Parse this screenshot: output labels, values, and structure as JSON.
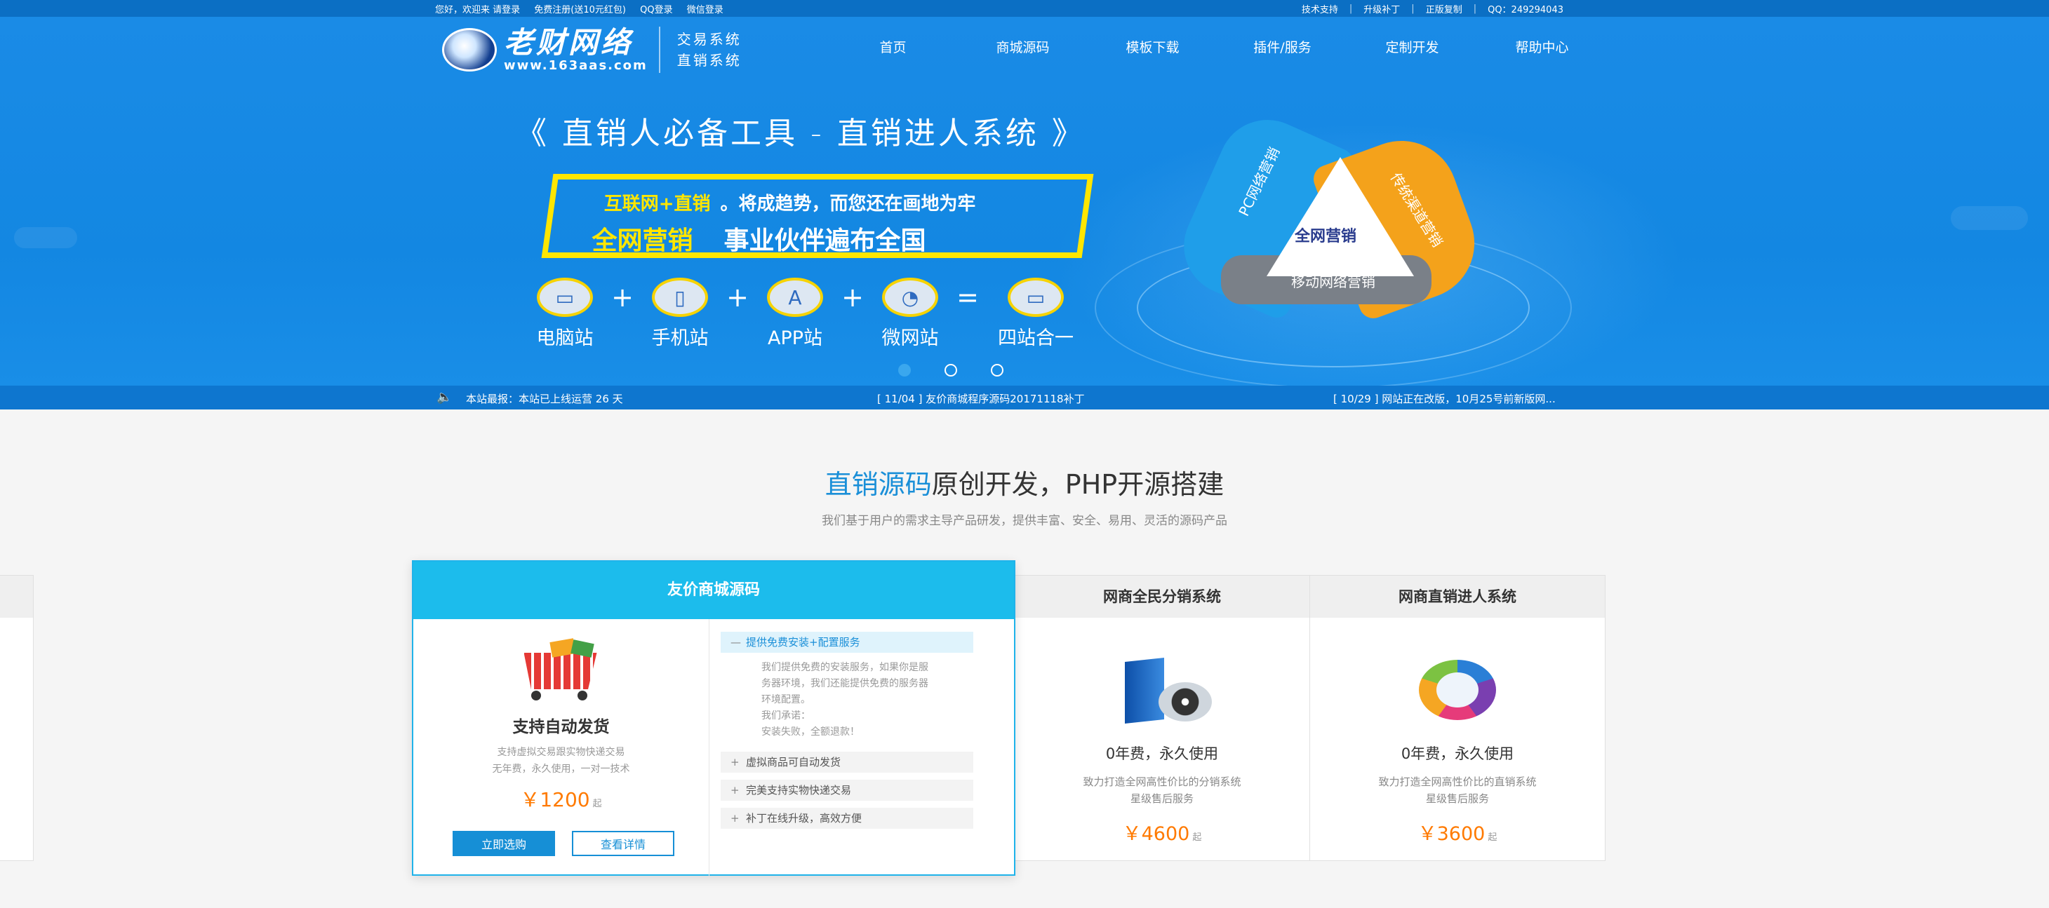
{
  "topbar": {
    "left": [
      "您好，欢迎来 请登录",
      "免费注册(送10元红包)",
      "QQ登录",
      "微信登录"
    ],
    "right": [
      "技术支持",
      "升级补丁",
      "正版复制",
      "QQ：249294043"
    ],
    "separator": "|"
  },
  "logo": {
    "brand": "老财网络",
    "url": "www.163aas.com",
    "sub1": "交易系统",
    "sub2": "直销系统"
  },
  "nav": [
    "首页",
    "商城源码",
    "模板下载",
    "插件/服务",
    "定制开发",
    "帮助中心"
  ],
  "banner": {
    "slogan": "《 直销人必备工具 - 直销进人系统 》",
    "line1_highlight": "互联网+直销",
    "line1_rest": "。将成趋势，而您还在画地为牢",
    "line2_highlight": "全网营销",
    "line2_rest": "事业伙伴遍布全国",
    "sites": [
      {
        "label": "电脑站",
        "icon": "monitor-icon",
        "glyph": "▭"
      },
      {
        "label": "手机站",
        "icon": "phone-icon",
        "glyph": "▯"
      },
      {
        "label": "APP站",
        "icon": "app-store-icon",
        "glyph": "A"
      },
      {
        "label": "微网站",
        "icon": "wechat-icon",
        "glyph": "◔"
      },
      {
        "label": "四站合一",
        "icon": "devices-icon",
        "glyph": "▭"
      }
    ],
    "operators": [
      "+",
      "+",
      "+",
      "="
    ],
    "triangle": {
      "center": "全网营销",
      "left": "PC网络营销",
      "right": "传统渠道营销",
      "bottom": "移动网络营销"
    },
    "slides_total": 3,
    "slide_active": 1
  },
  "news": {
    "items": [
      "本站最报：本站已上线运营 26 天",
      "[ 11/04 ] 友价商城程序源码20171118补丁",
      "[ 10/29 ] 网站正在改版，10月25号前新版网..."
    ]
  },
  "section": {
    "title_highlight": "直销源码",
    "title_rest": "原创开发，PHP开源搭建",
    "subtitle": "我们基于用户的需求主导产品研发，提供丰富、安全、易用、灵活的源码产品"
  },
  "featured": {
    "header": "友价商城源码",
    "title": "支持自动发货",
    "desc1": "支持虚拟交易跟实物快递交易",
    "desc2": "无年费，永久使用，一对一技术",
    "price": "￥1200",
    "price_unit": "起",
    "buy_label": "立即选购",
    "detail_label": "查看详情",
    "accordion": [
      {
        "title": "提供免费安装+配置服务",
        "open": true,
        "symbol": "—",
        "body": [
          "我们提供免费的安装服务，如果你是服",
          "务器环境，我们还能提供免费的服务器",
          "环境配置。",
          "我们承诺：",
          "安装失败，全额退款！"
        ]
      },
      {
        "title": "虚拟商品可自动发货",
        "open": false,
        "symbol": "+"
      },
      {
        "title": "完美支持实物快递交易",
        "open": false,
        "symbol": "+"
      },
      {
        "title": "补丁在线升级，高效方便",
        "open": false,
        "symbol": "+"
      }
    ]
  },
  "cards": [
    {
      "header": "网商全民分销系统",
      "free": "0年费，永久使用",
      "desc1": "致力打造全网高性价比的分销系统",
      "desc2": "星级售后服务",
      "price": "￥4600",
      "price_unit": "起",
      "image": "software-box-image"
    },
    {
      "header": "网商直销进人系统",
      "free": "0年费，永久使用",
      "desc1": "致力打造全网高性价比的直销系统",
      "desc2": "星级售后服务",
      "price": "￥3600",
      "price_unit": "起",
      "image": "cycle-chart-image"
    }
  ],
  "colors": {
    "brand_blue": "#1387e2",
    "accent_cyan": "#1cbcec",
    "price_orange": "#ff7a00",
    "slogan_yellow": "#ffe600"
  }
}
